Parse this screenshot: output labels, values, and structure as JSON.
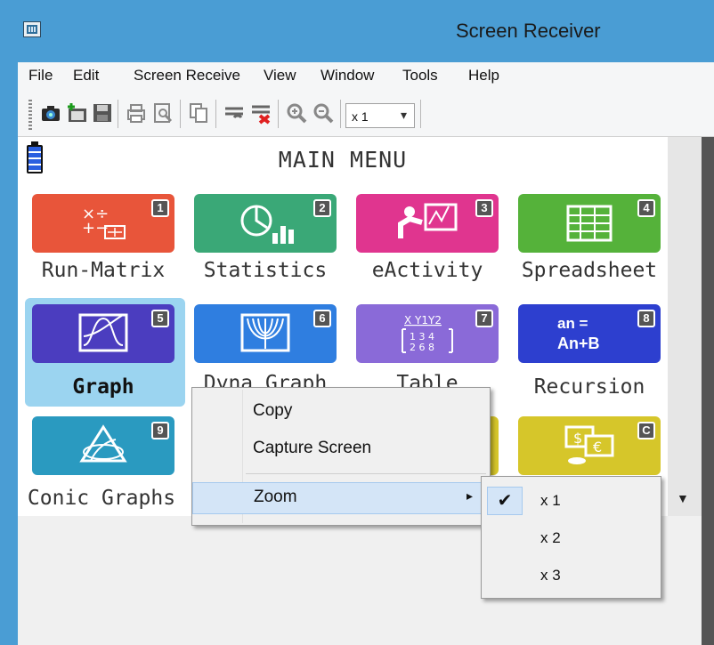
{
  "window": {
    "title": "Screen Receiver"
  },
  "menu": [
    "File",
    "Edit",
    "Screen Receive",
    "View",
    "Window",
    "Tools",
    "Help"
  ],
  "toolbar": {
    "icons": [
      "camera-icon",
      "new-folder-icon",
      "save-icon",
      "print-icon",
      "print-preview-icon",
      "copy-icon",
      "connect-icon",
      "disconnect-icon",
      "zoom-in-icon",
      "zoom-out-icon"
    ],
    "zoom_value": "x 1"
  },
  "screen": {
    "title": "MAIN MENU",
    "tiles": [
      {
        "label": "Run-Matrix",
        "num": "1",
        "color": "#e8553a"
      },
      {
        "label": "Statistics",
        "num": "2",
        "color": "#3aa877"
      },
      {
        "label": "eActivity",
        "num": "3",
        "color": "#e0358f"
      },
      {
        "label": "Spreadsheet",
        "num": "4",
        "color": "#55b23a"
      },
      {
        "label": "Graph",
        "num": "5",
        "color": "#4b3dbf"
      },
      {
        "label": "Dyna Graph",
        "num": "6",
        "color": "#2f7ee0"
      },
      {
        "label": "Table",
        "num": "7",
        "color": "#8a6ad8"
      },
      {
        "label": "Recursion",
        "num": "8",
        "color": "#2d3fcf"
      },
      {
        "label": "Conic Graphs",
        "num": "9",
        "color": "#2a9ac0"
      },
      {
        "label": "",
        "num": "C",
        "color": "#d6c62a"
      }
    ],
    "tile_text": {
      "recursion_line1": "an =",
      "recursion_line2": "An+B",
      "table_header": "X Y1Y2"
    }
  },
  "context_menu": {
    "items": [
      "Copy",
      "Capture Screen",
      "Zoom"
    ],
    "submenu": {
      "items": [
        "x 1",
        "x 2",
        "x 3"
      ],
      "checked": "x 1",
      "check_glyph": "✔"
    },
    "arrow": "▸"
  },
  "scroll": {
    "down_arrow": "▼"
  }
}
